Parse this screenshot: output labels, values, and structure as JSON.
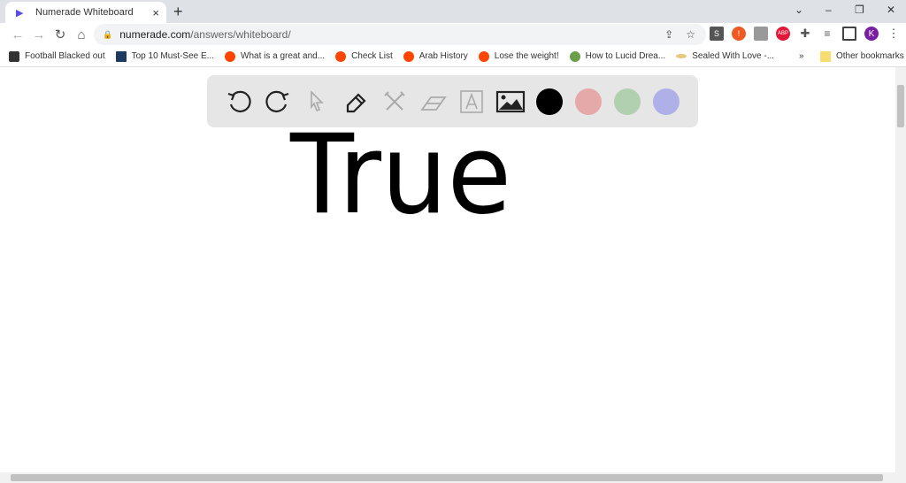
{
  "tab": {
    "title": "Numerade Whiteboard",
    "close": "×",
    "new_tab": "+"
  },
  "window": {
    "menu": "⌄",
    "minimize": "–",
    "restore": "❐",
    "close": "✕"
  },
  "address": {
    "host": "numerade.com",
    "path": "/answers/whiteboard/"
  },
  "extensions": {
    "s": "S",
    "abp": "ABP",
    "avatar": "K"
  },
  "bookmarks": [
    {
      "label": "Football Blacked out"
    },
    {
      "label": "Top 10 Must-See E..."
    },
    {
      "label": "What is a great and..."
    },
    {
      "label": "Check List"
    },
    {
      "label": "Arab History"
    },
    {
      "label": "Lose the weight!"
    },
    {
      "label": "How to Lucid Drea..."
    },
    {
      "label": "Sealed With Love -..."
    }
  ],
  "bookmarks_more": "»",
  "other_bookmarks": "Other bookmarks",
  "colors": {
    "black": "#000000",
    "pink": "#e6a9a9",
    "green": "#b0d0b0",
    "purple": "#b0b0e8"
  },
  "canvas": {
    "handwritten_text": "True"
  }
}
